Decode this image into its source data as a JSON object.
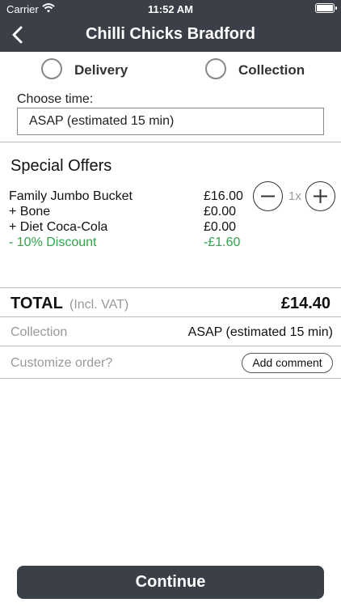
{
  "status_bar": {
    "carrier": "Carrier",
    "time": "11:52 AM"
  },
  "nav": {
    "title": "Chilli Chicks Bradford",
    "back_icon": "chevron-left-icon"
  },
  "order_type": {
    "options": [
      {
        "label": "Delivery",
        "selected": false
      },
      {
        "label": "Collection",
        "selected": false
      }
    ]
  },
  "time_picker": {
    "label": "Choose time:",
    "value": "ASAP (estimated 15 min)"
  },
  "offers": {
    "title": "Special Offers",
    "items": [
      {
        "name": "Family Jumbo Bucket",
        "price": "£16.00"
      },
      {
        "name": "+ Bone",
        "price": "£0.00"
      },
      {
        "name": "+ Diet Coca-Cola",
        "price": "£0.00"
      },
      {
        "name": "- 10% Discount",
        "price": "-£1.60",
        "color": "#2aa84a"
      }
    ],
    "quantity": "1x"
  },
  "total": {
    "label": "TOTAL",
    "sublabel": "(Incl. VAT)",
    "value": "£14.40"
  },
  "collection": {
    "label": "Collection",
    "value": "ASAP (estimated 15 min)"
  },
  "customize": {
    "label": "Customize order?",
    "button": "Add comment"
  },
  "continue_label": "Continue",
  "colors": {
    "header": "#3a3f48",
    "discount": "#2aa84a"
  }
}
